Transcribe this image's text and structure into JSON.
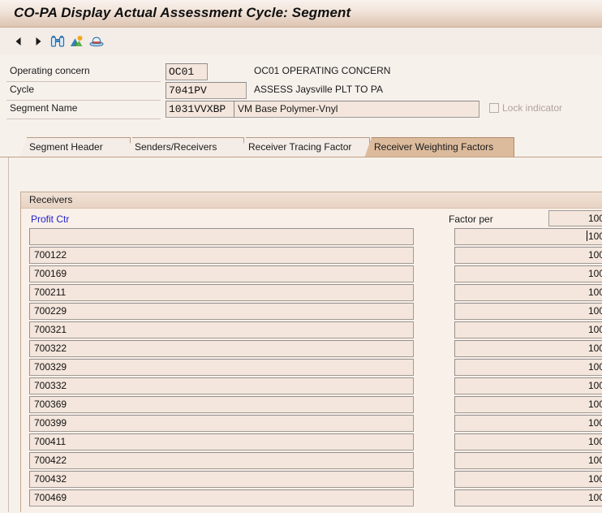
{
  "window": {
    "title": "CO-PA Display Actual Assessment Cycle: Segment"
  },
  "toolbar": {
    "items": [
      {
        "name": "back-arrow",
        "label": "Back"
      },
      {
        "name": "forward-arrow",
        "label": "Forward"
      },
      {
        "name": "find-binoculars",
        "label": "Find"
      },
      {
        "name": "find-next-mountains",
        "label": "Find Next"
      },
      {
        "name": "print-preview-hat",
        "label": "Print Preview"
      }
    ]
  },
  "header_form": {
    "rows": [
      {
        "label": "Operating concern",
        "key_value": "OC01",
        "description": "OC01 OPERATING CONCERN"
      },
      {
        "label": "Cycle",
        "key_value": "7041PV",
        "description": "ASSESS Jaysville PLT TO PA"
      },
      {
        "label": "Segment Name",
        "key_value": "1031VVXBP",
        "description_value": "VM Base Polymer-Vnyl"
      }
    ],
    "lock_indicator": {
      "label": "Lock indicator",
      "checked": false,
      "enabled": false
    }
  },
  "tabs": {
    "items": [
      {
        "label": "Segment Header",
        "active": false
      },
      {
        "label": "Senders/Receivers",
        "active": false
      },
      {
        "label": "Receiver Tracing Factor",
        "active": false
      },
      {
        "label": "Receiver Weighting Factors",
        "active": true
      }
    ]
  },
  "receivers_panel": {
    "title": "Receivers",
    "column_header": "Profit Ctr",
    "factor_per_label": "Factor per",
    "factor_per_value": "100",
    "rows": [
      {
        "profit_ctr": "",
        "factor": "100",
        "focused": true
      },
      {
        "profit_ctr": "700122",
        "factor": "100",
        "focused": false
      },
      {
        "profit_ctr": "700169",
        "factor": "100",
        "focused": false
      },
      {
        "profit_ctr": "700211",
        "factor": "100",
        "focused": false
      },
      {
        "profit_ctr": "700229",
        "factor": "100",
        "focused": false
      },
      {
        "profit_ctr": "700321",
        "factor": "100",
        "focused": false
      },
      {
        "profit_ctr": "700322",
        "factor": "100",
        "focused": false
      },
      {
        "profit_ctr": "700329",
        "factor": "100",
        "focused": false
      },
      {
        "profit_ctr": "700332",
        "factor": "100",
        "focused": false
      },
      {
        "profit_ctr": "700369",
        "factor": "100",
        "focused": false
      },
      {
        "profit_ctr": "700399",
        "factor": "100",
        "focused": false
      },
      {
        "profit_ctr": "700411",
        "factor": "100",
        "focused": false
      },
      {
        "profit_ctr": "700422",
        "factor": "100",
        "focused": false
      },
      {
        "profit_ctr": "700432",
        "factor": "100",
        "focused": false
      },
      {
        "profit_ctr": "700469",
        "factor": "100",
        "focused": false
      }
    ]
  },
  "colors": {
    "title_gradient_top": "#f8f2ee",
    "title_gradient_bottom": "#dcc3b1",
    "page_background": "#f7f1ec",
    "field_background": "#f4e6dc",
    "active_tab": "#dcbb9c",
    "column_header_link": "#2222cc",
    "focus_marker": "#e02020"
  }
}
